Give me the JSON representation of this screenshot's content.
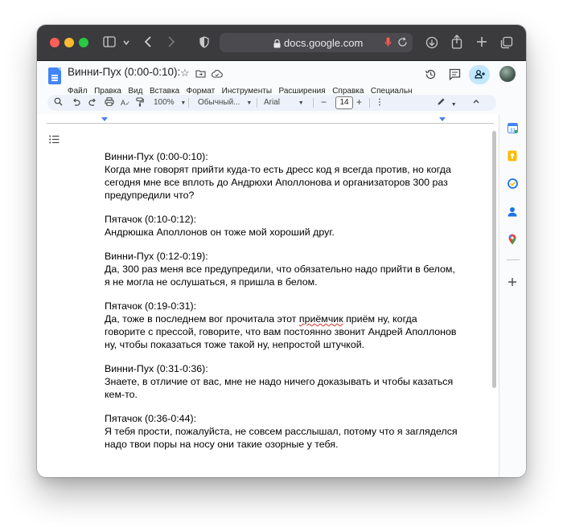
{
  "browser": {
    "url": "docs.google.com",
    "icons": {
      "sidebar": "sidebar-icon",
      "chevron": "chevron-down-icon",
      "back": "back-icon",
      "forward": "forward-icon",
      "privacy": "shield-icon",
      "lock": "lock-icon",
      "mic": "mic-icon",
      "reload": "reload-icon",
      "download": "download-icon",
      "share": "share-icon",
      "new_tab": "plus-icon",
      "tabs": "tab-overview-icon"
    }
  },
  "doc": {
    "title": "Винни-Пух (0:00-0:10):",
    "menu": [
      "Файл",
      "Правка",
      "Вид",
      "Вставка",
      "Формат",
      "Инструменты",
      "Расширения",
      "Справка",
      "Специальн"
    ]
  },
  "toolbar": {
    "zoom": "100%",
    "style": "Обычный...",
    "font": "Arial",
    "size": "14",
    "minus": "−",
    "plus": "+"
  },
  "content": [
    {
      "speaker": "Винни-Пух (0:00-0:10):",
      "lines": [
        "Когда мне говорят прийти куда-то есть дресс код я всегда против, но когда",
        "сегодня мне все вплоть до Андрюхи Аполлонова и организаторов 300 раз",
        "предупредили что?"
      ]
    },
    {
      "speaker": "Пятачок (0:10-0:12):",
      "lines": [
        "Андрюшка Аполлонов он тоже мой хороший друг."
      ]
    },
    {
      "speaker": "Винни-Пух (0:12-0:19):",
      "lines": [
        "Да, 300 раз меня все предупредили, что обязательно надо прийти в белом,",
        "я не могла не ослушаться, я пришла в белом."
      ]
    },
    {
      "speaker": "Пятачок (0:19-0:31):",
      "lines_special": {
        "before": "Да, тоже в последнем вог прочитала этот ",
        "misspelled": "приёмчик",
        "after": " приём ну, когда"
      },
      "lines": [
        "говорите с прессой, говорите, что вам постоянно звонит Андрей Аполлонов",
        "ну, чтобы показаться тоже такой ну, непростой штучкой."
      ]
    },
    {
      "speaker": "Винни-Пух (0:31-0:36):",
      "lines": [
        "Знаете, в отличие от вас, мне не надо ничего доказывать и чтобы казаться",
        "кем-то."
      ]
    },
    {
      "speaker": "Пятачок (0:36-0:44):",
      "lines": [
        "Я тебя прости, пожалуйста, не совсем расслышал, потому что я загляделся",
        "надо твои поры на носу они такие озорные у тебя."
      ]
    }
  ],
  "colors": {
    "browser_bar": "#3b3a3d",
    "accent": "#4285f4",
    "share_button": "#c2e7ff",
    "toolbar_bg": "#edf2fa"
  }
}
